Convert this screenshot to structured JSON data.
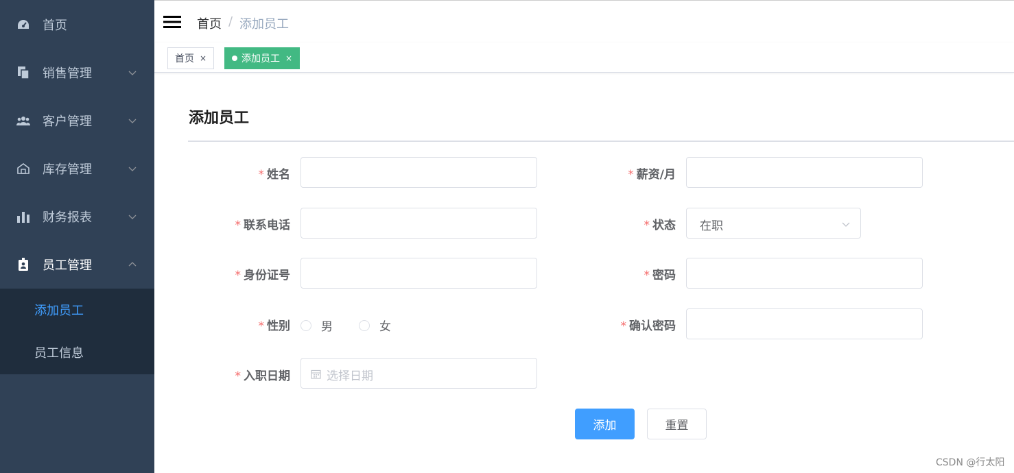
{
  "sidebar": {
    "items": [
      {
        "label": "首页",
        "icon": "dashboard-icon"
      },
      {
        "label": "销售管理",
        "icon": "document-copy-icon"
      },
      {
        "label": "客户管理",
        "icon": "users-icon"
      },
      {
        "label": "库存管理",
        "icon": "warehouse-icon"
      },
      {
        "label": "财务报表",
        "icon": "bar-chart-icon"
      },
      {
        "label": "员工管理",
        "icon": "id-badge-icon"
      }
    ],
    "submenu": [
      {
        "label": "添加员工",
        "active": true
      },
      {
        "label": "员工信息",
        "active": false
      }
    ],
    "active_color": "#409eff",
    "background": "#304156"
  },
  "navbar": {
    "breadcrumb": {
      "home": "首页",
      "separator": "/",
      "current": "添加员工"
    }
  },
  "tags": [
    {
      "label": "首页",
      "close": "×",
      "active": false
    },
    {
      "label": "添加员工",
      "close": "×",
      "active": true
    }
  ],
  "tag_active_color": "#42b983",
  "page": {
    "title": "添加员工"
  },
  "form": {
    "required_mark": "*",
    "fields": {
      "name": {
        "label": "姓名",
        "value": ""
      },
      "phone": {
        "label": "联系电话",
        "value": ""
      },
      "id_card": {
        "label": "身份证号",
        "value": ""
      },
      "gender": {
        "label": "性别",
        "options": [
          "男",
          "女"
        ],
        "selected": null
      },
      "hire_date": {
        "label": "入职日期",
        "placeholder": "选择日期",
        "value": ""
      },
      "salary": {
        "label": "薪资/月",
        "value": ""
      },
      "status": {
        "label": "状态",
        "value": "在职"
      },
      "password": {
        "label": "密码",
        "value": ""
      },
      "confirm_password": {
        "label": "确认密码",
        "value": ""
      }
    },
    "buttons": {
      "submit": "添加",
      "reset": "重置"
    }
  },
  "watermark": "CSDN @行太阳"
}
